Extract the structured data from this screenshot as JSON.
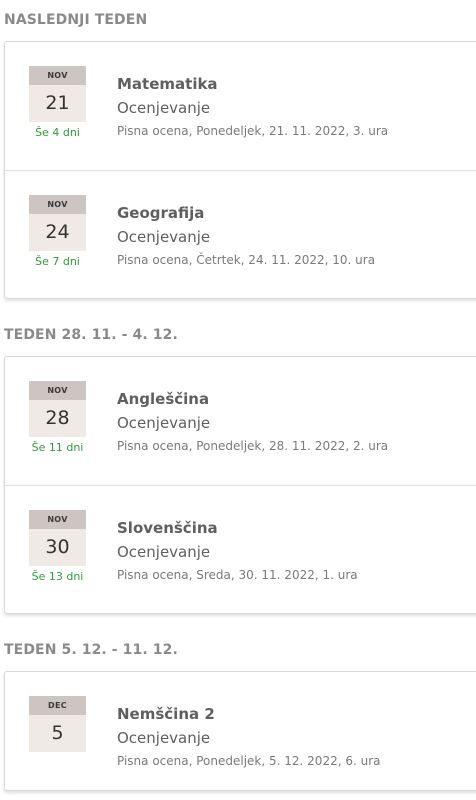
{
  "sections": [
    {
      "title": "NASLEDNJI TEDEN",
      "events": [
        {
          "month": "NOV",
          "day": "21",
          "remaining": "Še 4 dni",
          "subject": "Matematika",
          "type": "Ocenjevanje",
          "details": "Pisna ocena, Ponedeljek, 21. 11. 2022, 3. ura"
        },
        {
          "month": "NOV",
          "day": "24",
          "remaining": "Še 7 dni",
          "subject": "Geografija",
          "type": "Ocenjevanje",
          "details": "Pisna ocena, Četrtek, 24. 11. 2022, 10. ura"
        }
      ]
    },
    {
      "title": "TEDEN 28. 11. - 4. 12.",
      "events": [
        {
          "month": "NOV",
          "day": "28",
          "remaining": "Še 11 dni",
          "subject": "Angleščina",
          "type": "Ocenjevanje",
          "details": "Pisna ocena, Ponedeljek, 28. 11. 2022, 2. ura"
        },
        {
          "month": "NOV",
          "day": "30",
          "remaining": "Še 13 dni",
          "subject": "Slovenščina",
          "type": "Ocenjevanje",
          "details": "Pisna ocena, Sreda, 30. 11. 2022, 1. ura"
        }
      ]
    },
    {
      "title": "TEDEN 5. 12. - 11. 12.",
      "events": [
        {
          "month": "DEC",
          "day": "5",
          "remaining": "",
          "subject": "Nemščina 2",
          "type": "Ocenjevanje",
          "details": "Pisna ocena, Ponedeljek, 5. 12. 2022, 6. ura"
        }
      ]
    }
  ]
}
